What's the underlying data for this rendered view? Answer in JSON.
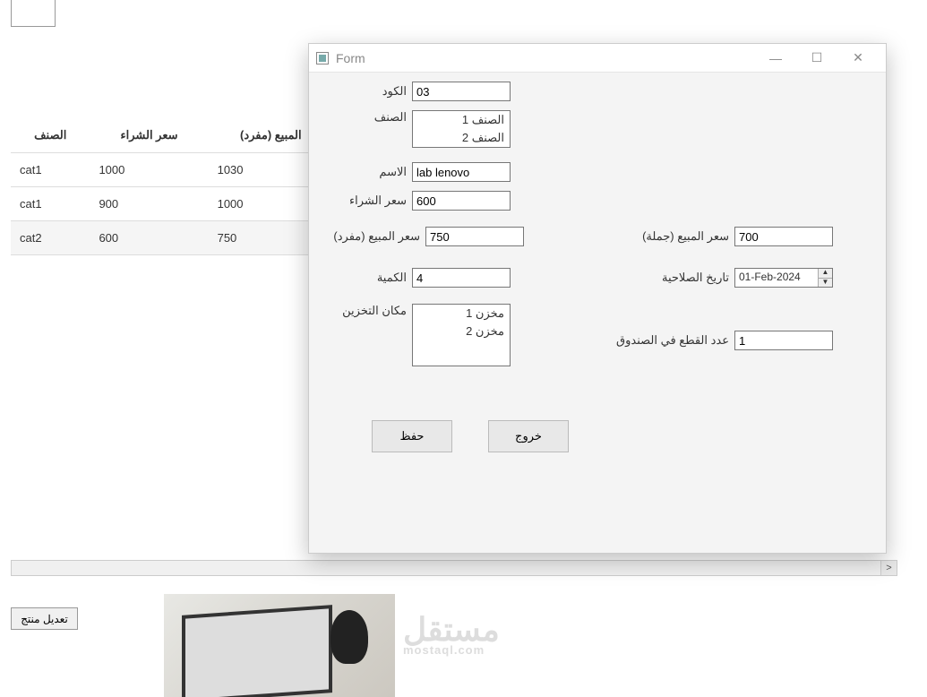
{
  "background_table": {
    "headers": [
      "الصنف",
      "سعر الشراء",
      "المبيع (مفرد)"
    ],
    "rows": [
      [
        "cat1",
        "1000",
        "1030"
      ],
      [
        "cat1",
        "900",
        "1000"
      ],
      [
        "cat2",
        "600",
        "750"
      ]
    ]
  },
  "edit_button_label": "تعديل منتج",
  "watermark": {
    "main": "مستقل",
    "sub": "mostaql.com"
  },
  "dialog": {
    "title": "Form",
    "labels": {
      "code": "الكود",
      "category": "الصنف",
      "name": "الاسم",
      "buy_price": "سعر الشراء",
      "sell_single": "سعر المبيع (مفرد)",
      "sell_bulk": "سعر المبيع (جملة)",
      "quantity": "الكمية",
      "expiry": "تاريخ الصلاحية",
      "storage": "مكان التخزين",
      "pieces_box": "عدد القطع في الصندوق"
    },
    "values": {
      "code": "03",
      "category_options": [
        "الصنف 1",
        "الصنف 2"
      ],
      "name": "lab lenovo",
      "buy_price": "600",
      "sell_single": "750",
      "sell_bulk": "700",
      "quantity": "4",
      "expiry": "01-Feb-2024",
      "storage_options": [
        "مخزن 1",
        "مخزن 2"
      ],
      "pieces_box": "1"
    },
    "buttons": {
      "save": "حفظ",
      "exit": "خروج"
    }
  }
}
